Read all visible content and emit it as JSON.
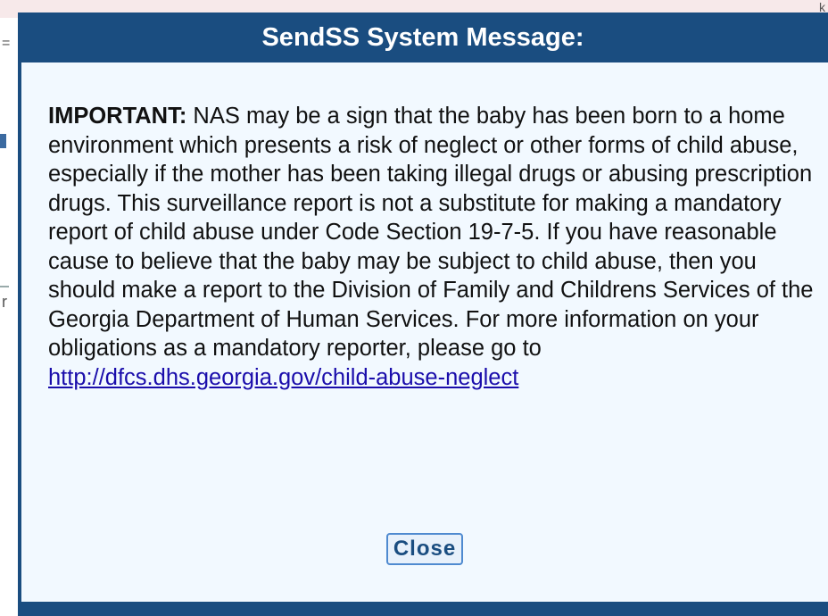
{
  "dialog": {
    "title": "SendSS System Message:",
    "important_label": "IMPORTANT:",
    "message_text": " NAS may be a sign that the baby has been born to a home environment which presents a risk of neglect or other forms of child abuse, especially if the mother has been taking illegal drugs or abusing prescription drugs. This surveillance report is not a substitute for making a mandatory report of child abuse under Code Section 19-7-5. If you have reasonable cause to believe that the baby may be subject to child abuse, then you should make a report to the Division of Family and Childrens Services of the Georgia Department of Human Services. For more information on your obligations as a mandatory reporter, please go to ",
    "link_text": "http://dfcs.dhs.georgia.gov/child-abuse-neglect",
    "close_label": "Close"
  },
  "background": {
    "mark_1": "=",
    "mark_2": "r",
    "mark_3": "k"
  },
  "colors": {
    "title_bar": "#1a4d80",
    "body_background": "#f2f9ff",
    "link": "#1a0dab",
    "background_strip": "#f7e9ea"
  }
}
